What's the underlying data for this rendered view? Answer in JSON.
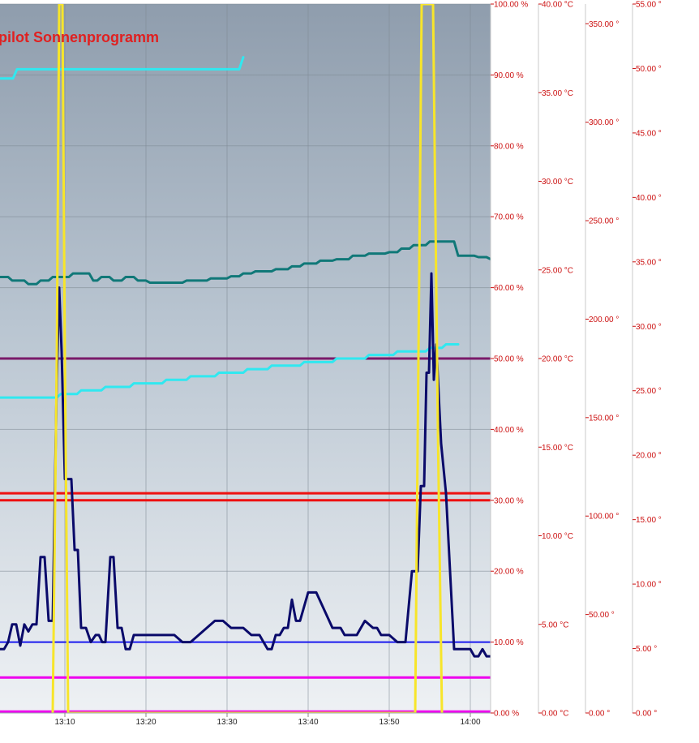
{
  "chart_data": {
    "type": "line",
    "title": "pilot Sonnenprogramm",
    "colors": {
      "bg_top": "#8f9dad",
      "bg_bottom": "#eef1f4",
      "grid": "#7d8894",
      "tick_text": "#cc1111",
      "axis_line": "#c8c8c8"
    },
    "x_axis": {
      "range": [
        "13:02",
        "14:02.5"
      ],
      "ticks": [
        "13:10",
        "13:20",
        "13:30",
        "13:40",
        "13:50",
        "14:00"
      ]
    },
    "y_axes": [
      {
        "id": "pct",
        "unit": "%",
        "range": [
          0,
          100
        ],
        "ticks": [
          "0.00 %",
          "10.00 %",
          "20.00 %",
          "30.00 %",
          "40.00 %",
          "50.00 %",
          "60.00 %",
          "70.00 %",
          "80.00 %",
          "90.00 %",
          "100.00 %"
        ]
      },
      {
        "id": "temp",
        "unit": "°C",
        "range": [
          0,
          40
        ],
        "ticks": [
          "0.00 °C",
          "5.00 °C",
          "10.00 °C",
          "15.00 °C",
          "20.00 °C",
          "25.00 °C",
          "30.00 °C",
          "35.00 °C",
          "40.00 °C"
        ]
      },
      {
        "id": "deg360",
        "unit": "°",
        "range": [
          0,
          360
        ],
        "ticks": [
          "0.00 °",
          "50.00 °",
          "100.00 °",
          "150.00 °",
          "200.00 °",
          "250.00 °",
          "300.00 °",
          "350.00 °"
        ]
      },
      {
        "id": "deg55",
        "unit": "°",
        "range": [
          0,
          55
        ],
        "ticks": [
          "0.00 °",
          "5.00 °",
          "10.00 °",
          "15.00 °",
          "20.00 °",
          "25.00 °",
          "30.00 °",
          "35.00 °",
          "40.00 °",
          "45.00 °",
          "50.00 °",
          "55.00 °"
        ]
      }
    ],
    "series": [
      {
        "color": "#ee00ee",
        "axis": "pct",
        "width": 3,
        "x": [
          0,
          60.5
        ],
        "y": [
          0.2,
          0.2
        ]
      },
      {
        "color": "#ee00ee",
        "axis": "pct",
        "width": 3,
        "x": [
          0,
          60.5
        ],
        "y": [
          5,
          5
        ]
      },
      {
        "color": "#1a1aee",
        "axis": "pct",
        "width": 2,
        "x": [
          0,
          60.5
        ],
        "y": [
          10,
          10
        ]
      },
      {
        "color": "#ee1111",
        "axis": "pct",
        "width": 3,
        "x": [
          0,
          60.5
        ],
        "y": [
          30,
          30
        ]
      },
      {
        "color": "#ee1111",
        "axis": "pct",
        "width": 3,
        "x": [
          0,
          60.5
        ],
        "y": [
          31,
          31
        ]
      },
      {
        "color": "#7a1a6a",
        "axis": "pct",
        "width": 3,
        "x": [
          0,
          60.5
        ],
        "y": [
          50,
          50
        ]
      },
      {
        "color": "#30e8f0",
        "axis": "pct",
        "width": 3,
        "x": [
          0,
          1.6,
          2.1,
          29.5,
          30.0
        ],
        "y": [
          89.5,
          89.5,
          90.8,
          90.8,
          92.5
        ]
      },
      {
        "color": "#30e8f0",
        "axis": "pct",
        "width": 3,
        "x": [
          0,
          7.0,
          7.5,
          9.5,
          10.0,
          12.5,
          13.0,
          16.0,
          16.5,
          20.0,
          20.5,
          23.0,
          23.5,
          26.5,
          27.0,
          30.0,
          30.5,
          33.0,
          33.5,
          37.0,
          37.5,
          41.0,
          41.5,
          45.0,
          45.5,
          48.5,
          49.0,
          52.5,
          53.0,
          54.5,
          55.0,
          56.5
        ],
        "y": [
          44.5,
          44.5,
          45.0,
          45.0,
          45.5,
          45.5,
          46.0,
          46.0,
          46.5,
          46.5,
          47.0,
          47.0,
          47.5,
          47.5,
          48.0,
          48.0,
          48.5,
          48.5,
          49.0,
          49.0,
          49.5,
          49.5,
          50.0,
          50.0,
          50.5,
          50.5,
          51.0,
          51.0,
          51.5,
          51.5,
          52.0,
          52.0
        ]
      },
      {
        "color": "#107878",
        "axis": "pct",
        "width": 3,
        "x": [
          0,
          1.0,
          1.5,
          3.0,
          3.5,
          4.5,
          5.0,
          6.0,
          6.5,
          8.5,
          9.0,
          11.0,
          11.5,
          12.0,
          12.5,
          13.5,
          14.0,
          15.0,
          15.5,
          16.5,
          17.0,
          18.0,
          18.5,
          22.5,
          23.0,
          25.5,
          26.0,
          28.0,
          28.5,
          29.5,
          30.0,
          31.0,
          31.5,
          33.5,
          34.0,
          35.5,
          36.0,
          37.0,
          37.5,
          39.0,
          39.5,
          41.0,
          41.5,
          43.0,
          43.5,
          45.0,
          45.5,
          47.5,
          48.0,
          49.0,
          49.5,
          50.5,
          51.0,
          52.5,
          53.0,
          56.0,
          56.5,
          58.5,
          59.0,
          60.0,
          60.5
        ],
        "y": [
          61.5,
          61.5,
          61.0,
          61.0,
          60.5,
          60.5,
          61.0,
          61.0,
          61.5,
          61.5,
          62.0,
          62.0,
          61.0,
          61.0,
          61.5,
          61.5,
          61.0,
          61.0,
          61.5,
          61.5,
          61.0,
          61.0,
          60.7,
          60.7,
          61.0,
          61.0,
          61.3,
          61.3,
          61.6,
          61.6,
          62.0,
          62.0,
          62.3,
          62.3,
          62.6,
          62.6,
          63.0,
          63.0,
          63.4,
          63.4,
          63.8,
          63.8,
          64.0,
          64.0,
          64.5,
          64.5,
          64.8,
          64.8,
          65.0,
          65.0,
          65.5,
          65.5,
          66.0,
          66.0,
          66.5,
          66.5,
          64.5,
          64.5,
          64.3,
          64.3,
          64.0
        ]
      },
      {
        "color": "#0a0a6a",
        "axis": "pct",
        "width": 3,
        "x": [
          0,
          0.5,
          1.0,
          1.5,
          2.0,
          2.5,
          3.0,
          3.5,
          4.0,
          4.5,
          5.0,
          5.5,
          6.0,
          6.5,
          7.0,
          7.3,
          7.6,
          8.0,
          8.4,
          8.8,
          9.2,
          9.6,
          10.0,
          10.6,
          11.2,
          11.8,
          12.2,
          12.6,
          13.0,
          13.6,
          14.0,
          14.5,
          15.0,
          15.5,
          16.0,
          16.5,
          17.0,
          18.0,
          21.5,
          22.5,
          23.5,
          24.5,
          25.5,
          26.5,
          27.5,
          28.5,
          29.0,
          30.0,
          31.0,
          32.0,
          32.5,
          33.0,
          33.5,
          34.0,
          34.5,
          35.0,
          35.5,
          36.0,
          36.5,
          37.0,
          38.0,
          39.0,
          41.0,
          42.0,
          42.5,
          43.0,
          44.0,
          45.0,
          46.0,
          46.5,
          47.0,
          48.0,
          49.0,
          50.0,
          50.8,
          51.5,
          51.9,
          52.3,
          52.6,
          52.9,
          53.2,
          53.5,
          53.8,
          54.4,
          55.0,
          56.0,
          57.0,
          57.5,
          58.0,
          58.5,
          59.0,
          59.5,
          60.0,
          60.5
        ],
        "y": [
          9,
          9,
          10,
          12.5,
          12.5,
          9.5,
          12.5,
          11.5,
          12.5,
          12.5,
          22,
          22,
          13,
          13,
          47,
          60,
          51,
          33,
          33,
          33,
          23,
          23,
          12,
          12,
          10,
          11,
          11,
          10,
          10,
          22,
          22,
          12,
          12,
          9,
          9,
          11,
          11,
          11,
          11,
          10,
          10,
          11,
          12,
          13,
          13,
          12,
          12,
          12,
          11,
          11,
          10,
          9,
          9,
          11,
          11,
          12,
          12,
          16,
          13,
          13,
          17,
          17,
          12,
          12,
          11,
          11,
          11,
          13,
          12,
          12,
          11,
          11,
          10,
          10,
          20,
          20,
          32,
          32,
          48,
          48,
          62,
          47,
          52,
          38,
          31,
          9,
          9,
          9,
          9,
          8,
          8,
          9,
          8,
          8
        ]
      },
      {
        "color": "#f7e52a",
        "axis": "pct",
        "width": 3,
        "x": [
          6.5,
          7.0,
          7.3,
          7.7,
          8.0,
          8.4,
          8.8,
          51.2,
          51.6,
          52.0,
          52.5,
          53.0,
          53.4,
          54.0,
          54.5
        ],
        "y": [
          0,
          50,
          100,
          100,
          50,
          0,
          0,
          0,
          50,
          100,
          100,
          100,
          100,
          40,
          0
        ]
      }
    ]
  }
}
